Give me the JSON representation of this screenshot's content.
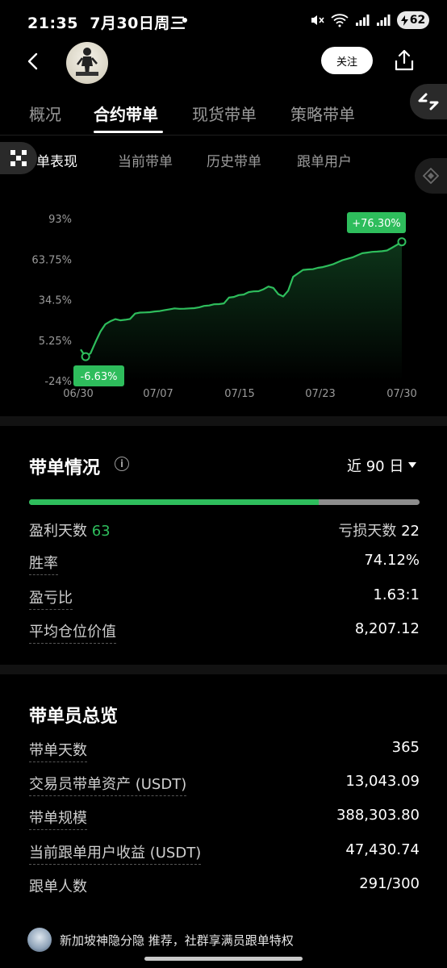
{
  "status_bar": {
    "time": "21:35",
    "date": "7月30日周三",
    "battery": "62"
  },
  "header": {
    "follow_label": "关注"
  },
  "main_tabs": [
    {
      "label": "概况"
    },
    {
      "label": "合约带单"
    },
    {
      "label": "现货带单"
    },
    {
      "label": "策略带单"
    }
  ],
  "sub_tabs": [
    {
      "label": "带单表现"
    },
    {
      "label": "当前带单"
    },
    {
      "label": "历史带单"
    },
    {
      "label": "跟单用户"
    }
  ],
  "chart_data": {
    "type": "area",
    "x_ticks": [
      "06/30",
      "07/07",
      "07/15",
      "07/23",
      "07/30"
    ],
    "y_ticks": [
      "93%",
      "63.75%",
      "34.5%",
      "5.25%",
      "-24%"
    ],
    "ylim": [
      -24,
      93
    ],
    "max_label": "+76.30%",
    "min_label": "-6.63%",
    "max_value": 76.3,
    "min_value": -6.63,
    "color": "#2ebd5c",
    "series": [
      {
        "values": [
          -1.5,
          -6.6,
          -4.2,
          4.0,
          11.5,
          16.8,
          18.9,
          20.5,
          19.6,
          20.0,
          20.6,
          24.5,
          25.2,
          25.3,
          25.5,
          26.0,
          26.3,
          27.0,
          27.6,
          28.2,
          27.9,
          28.0,
          28.2,
          28.4,
          29.0,
          30.0,
          30.3,
          31.2,
          31.3,
          31.8,
          36.0,
          36.5,
          37.8,
          38.2,
          40.0,
          40.5,
          40.6,
          42.0,
          44.0,
          43.0,
          38.5,
          36.8,
          41.0,
          51.0,
          53.5,
          56.0,
          56.3,
          56.5,
          57.5,
          58.0,
          59.0,
          60.0,
          61.5,
          63.0,
          64.0,
          65.0,
          66.5,
          68.0,
          68.5,
          69.0,
          69.2,
          69.5,
          70.0,
          72.0,
          74.0,
          76.3
        ]
      }
    ]
  },
  "performance": {
    "title": "带单情况",
    "period": "近 90 日",
    "win_ratio": 0.7412,
    "profit_days_label": "盈利天数",
    "profit_days": "63",
    "loss_days_label": "亏损天数",
    "loss_days": "22",
    "rows": [
      {
        "label": "胜率",
        "value": "74.12%"
      },
      {
        "label": "盈亏比",
        "value": "1.63:1"
      },
      {
        "label": "平均仓位价值",
        "value": "8,207.12"
      }
    ]
  },
  "overview": {
    "title": "带单员总览",
    "rows": [
      {
        "label": "带单天数",
        "value": "365"
      },
      {
        "label": "交易员带单资产 (USDT)",
        "value": "13,043.09"
      },
      {
        "label": "带单规模",
        "value": "388,303.80"
      },
      {
        "label": "当前跟单用户收益 (USDT)",
        "value": "47,430.74"
      },
      {
        "label": "跟单人数",
        "value": "291/300"
      }
    ]
  },
  "footer": {
    "text": "新加坡神隐分隐 推荐，社群享满员跟单特权"
  }
}
